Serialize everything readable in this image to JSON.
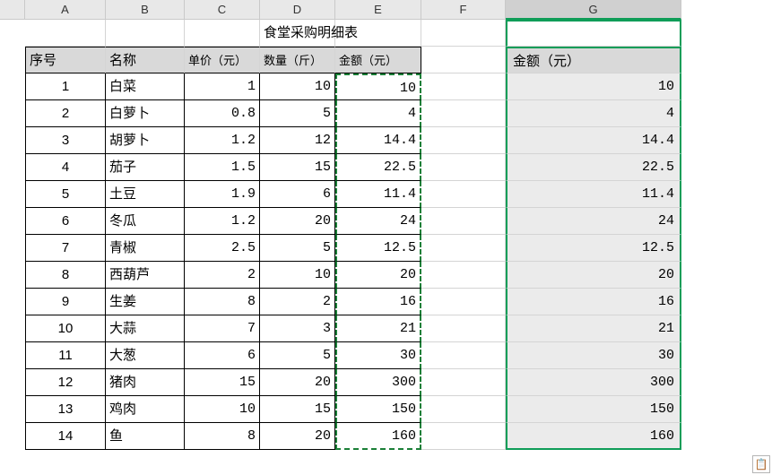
{
  "columns": [
    "A",
    "B",
    "C",
    "D",
    "E",
    "F",
    "G"
  ],
  "title": "食堂采购明细表",
  "headers": {
    "seq": "序号",
    "name": "名称",
    "price": "单价（元）",
    "qty": "数量（斤）",
    "amount": "金额（元）"
  },
  "g_header": "金额（元）",
  "rows": [
    {
      "seq": "1",
      "name": "白菜",
      "price": "1",
      "qty": "10",
      "amount": "10",
      "g": "10"
    },
    {
      "seq": "2",
      "name": "白萝卜",
      "price": "0.8",
      "qty": "5",
      "amount": "4",
      "g": "4"
    },
    {
      "seq": "3",
      "name": "胡萝卜",
      "price": "1.2",
      "qty": "12",
      "amount": "14.4",
      "g": "14.4"
    },
    {
      "seq": "4",
      "name": "茄子",
      "price": "1.5",
      "qty": "15",
      "amount": "22.5",
      "g": "22.5"
    },
    {
      "seq": "5",
      "name": "土豆",
      "price": "1.9",
      "qty": "6",
      "amount": "11.4",
      "g": "11.4"
    },
    {
      "seq": "6",
      "name": "冬瓜",
      "price": "1.2",
      "qty": "20",
      "amount": "24",
      "g": "24"
    },
    {
      "seq": "7",
      "name": "青椒",
      "price": "2.5",
      "qty": "5",
      "amount": "12.5",
      "g": "12.5"
    },
    {
      "seq": "8",
      "name": "西葫芦",
      "price": "2",
      "qty": "10",
      "amount": "20",
      "g": "20"
    },
    {
      "seq": "9",
      "name": "生姜",
      "price": "8",
      "qty": "2",
      "amount": "16",
      "g": "16"
    },
    {
      "seq": "10",
      "name": "大蒜",
      "price": "7",
      "qty": "3",
      "amount": "21",
      "g": "21"
    },
    {
      "seq": "11",
      "name": "大葱",
      "price": "6",
      "qty": "5",
      "amount": "30",
      "g": "30"
    },
    {
      "seq": "12",
      "name": "猪肉",
      "price": "15",
      "qty": "20",
      "amount": "300",
      "g": "300"
    },
    {
      "seq": "13",
      "name": "鸡肉",
      "price": "10",
      "qty": "15",
      "amount": "150",
      "g": "150"
    },
    {
      "seq": "14",
      "name": "鱼",
      "price": "8",
      "qty": "20",
      "amount": "160",
      "g": "160"
    }
  ],
  "chart_data": {
    "type": "table",
    "title": "食堂采购明细表",
    "columns": [
      "序号",
      "名称",
      "单价（元）",
      "数量（斤）",
      "金额（元）"
    ],
    "data": [
      [
        1,
        "白菜",
        1,
        10,
        10
      ],
      [
        2,
        "白萝卜",
        0.8,
        5,
        4
      ],
      [
        3,
        "胡萝卜",
        1.2,
        12,
        14.4
      ],
      [
        4,
        "茄子",
        1.5,
        15,
        22.5
      ],
      [
        5,
        "土豆",
        1.9,
        6,
        11.4
      ],
      [
        6,
        "冬瓜",
        1.2,
        20,
        24
      ],
      [
        7,
        "青椒",
        2.5,
        5,
        12.5
      ],
      [
        8,
        "西葫芦",
        2,
        10,
        20
      ],
      [
        9,
        "生姜",
        8,
        2,
        16
      ],
      [
        10,
        "大蒜",
        7,
        3,
        21
      ],
      [
        11,
        "大葱",
        6,
        5,
        30
      ],
      [
        12,
        "猪肉",
        15,
        20,
        300
      ],
      [
        13,
        "鸡肉",
        10,
        15,
        150
      ],
      [
        14,
        "鱼",
        8,
        20,
        160
      ]
    ]
  }
}
